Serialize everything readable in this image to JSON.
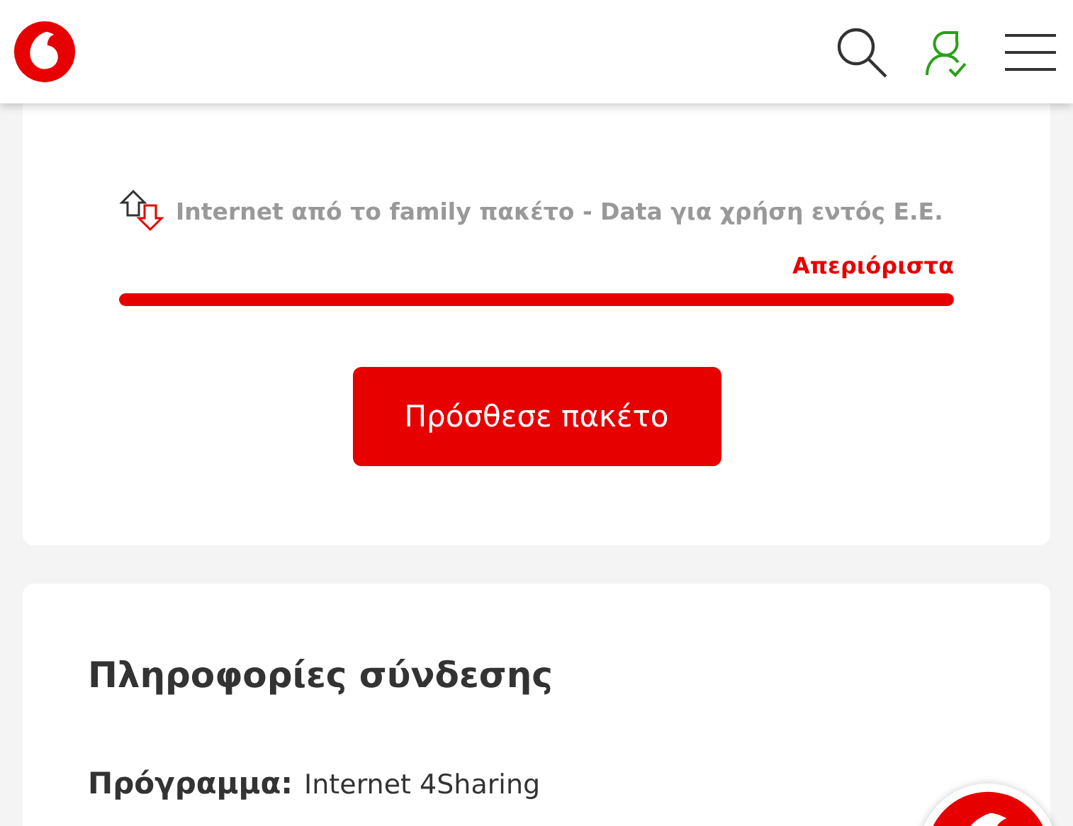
{
  "usage": {
    "label": "Internet από το family πακέτο - Data για χρήση εντός Ε.Ε.",
    "remaining": "Απεριόριστα"
  },
  "add_button": "Πρόσθεσε πακέτο",
  "connection": {
    "title": "Πληροφορίες σύνδεσης",
    "fields": [
      {
        "label": "Πρόγραμμα:",
        "value": "Internet 4Sharing"
      }
    ]
  }
}
